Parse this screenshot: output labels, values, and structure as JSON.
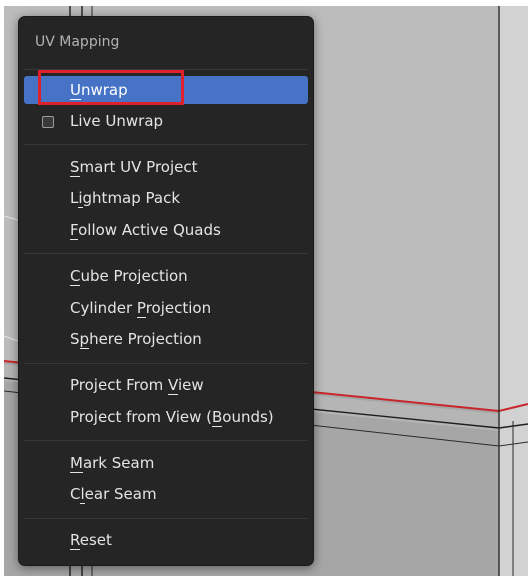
{
  "menu": {
    "title": "UV Mapping",
    "items": [
      {
        "id": "unwrap",
        "label": "Unwrap",
        "underline": 0,
        "active": true
      },
      {
        "id": "live-unwrap",
        "label": "Live Unwrap",
        "checkbox": true,
        "checked": false
      },
      {
        "id": "smart-uv-project",
        "label": "Smart UV Project",
        "underline": 0
      },
      {
        "id": "lightmap-pack",
        "label": "Lightmap Pack",
        "underline": 1
      },
      {
        "id": "follow-active-quads",
        "label": "Follow Active Quads",
        "underline": 0
      },
      {
        "id": "cube-projection",
        "label": "Cube Projection",
        "underline": 0
      },
      {
        "id": "cylinder-projection",
        "label": "Cylinder Projection",
        "underline": 9
      },
      {
        "id": "sphere-projection",
        "label": "Sphere Projection",
        "underline": 1
      },
      {
        "id": "project-from-view",
        "label": "Project From View",
        "underline": 13
      },
      {
        "id": "project-from-view-bounds",
        "label": "Project from View (Bounds)",
        "underline": 19
      },
      {
        "id": "mark-seam",
        "label": "Mark Seam",
        "underline": 0
      },
      {
        "id": "clear-seam",
        "label": "Clear Seam",
        "underline": 1
      },
      {
        "id": "reset",
        "label": "Reset",
        "underline": 0
      }
    ]
  },
  "colors": {
    "menu_background": "#252525",
    "active_item": "#4673c6",
    "annotation_box": "#e0202c",
    "seam_edge": "#c8262a",
    "viewport_background": "#b9b9b9",
    "mesh_face": "#9a9a9a"
  }
}
